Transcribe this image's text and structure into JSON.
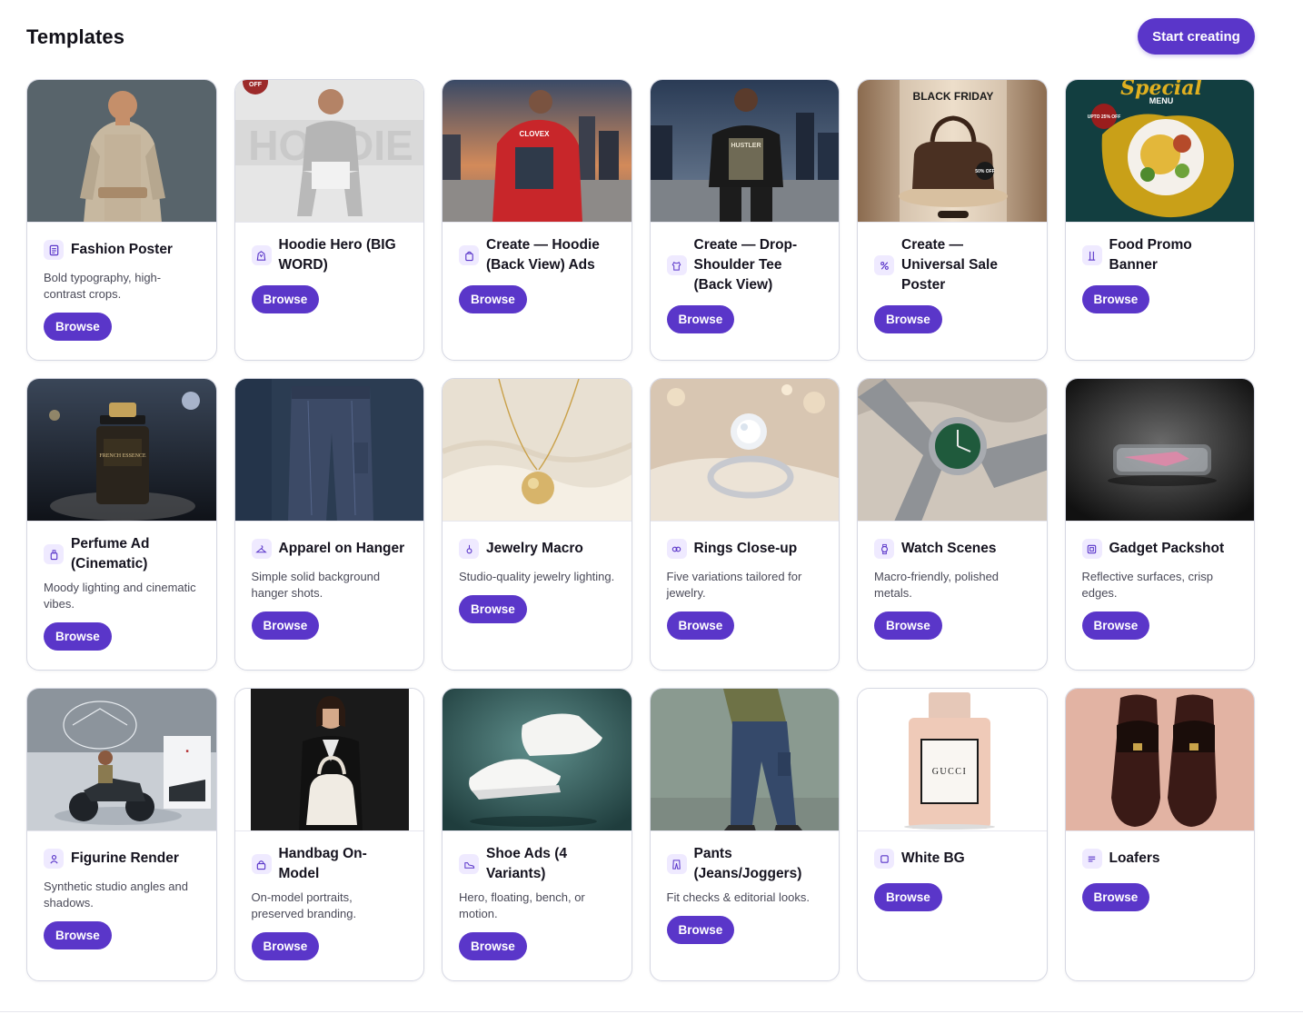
{
  "header": {
    "title": "Templates",
    "start_label": "Start creating"
  },
  "accent": "#5a36c9",
  "browse_label": "Browse",
  "cards": [
    {
      "title": "Fashion Poster",
      "desc": "Bold typography, high-contrast crops.",
      "icon": "document-icon"
    },
    {
      "title": "Hoodie Hero (BIG WORD)",
      "desc": "",
      "icon": "hoodie-icon",
      "thumb_text": "HOODIE",
      "badge": "OFF"
    },
    {
      "title": "Create — Hoodie (Back View) Ads",
      "desc": "",
      "icon": "bag-icon",
      "thumb_text": "CLOVEX"
    },
    {
      "title": "Create — Drop-Shoulder Tee (Back View)",
      "desc": "",
      "icon": "shirt-icon",
      "thumb_text": "HUSTLER"
    },
    {
      "title": "Create — Universal Sale Poster",
      "desc": "",
      "icon": "percent-icon",
      "thumb_text": "BLACK FRIDAY",
      "badge": "50% OFF"
    },
    {
      "title": "Food Promo Banner",
      "desc": "",
      "icon": "utensils-icon",
      "thumb_text": "Special",
      "thumb_sub": "MENU",
      "badge": "UPTO 25% OFF"
    },
    {
      "title": "Perfume Ad (Cinematic)",
      "desc": "Moody lighting and cinematic vibes.",
      "icon": "perfume-icon",
      "thumb_text": "FRENCH ESSENCE"
    },
    {
      "title": "Apparel on Hanger",
      "desc": "Simple solid background hanger shots.",
      "icon": "hanger-icon"
    },
    {
      "title": "Jewelry Macro",
      "desc": "Studio-quality jewelry lighting.",
      "icon": "pendant-icon"
    },
    {
      "title": "Rings Close-up",
      "desc": "Five variations tailored for jewelry.",
      "icon": "rings-icon"
    },
    {
      "title": "Watch Scenes",
      "desc": "Macro-friendly, polished metals.",
      "icon": "watch-icon"
    },
    {
      "title": "Gadget Packshot",
      "desc": "Reflective surfaces, crisp edges.",
      "icon": "gadget-icon"
    },
    {
      "title": "Figurine Render",
      "desc": "Synthetic studio angles and shadows.",
      "icon": "person-icon"
    },
    {
      "title": "Handbag On-Model",
      "desc": "On-model portraits, preserved branding.",
      "icon": "lock-bag-icon"
    },
    {
      "title": "Shoe Ads (4 Variants)",
      "desc": "Hero, floating, bench, or motion.",
      "icon": "shoe-icon"
    },
    {
      "title": "Pants (Jeans/Joggers)",
      "desc": "Fit checks & editorial looks.",
      "icon": "pants-icon"
    },
    {
      "title": "White BG",
      "desc": "",
      "icon": "square-icon",
      "thumb_text": "GUCCI"
    },
    {
      "title": "Loafers",
      "desc": "",
      "icon": "lines-icon"
    }
  ]
}
